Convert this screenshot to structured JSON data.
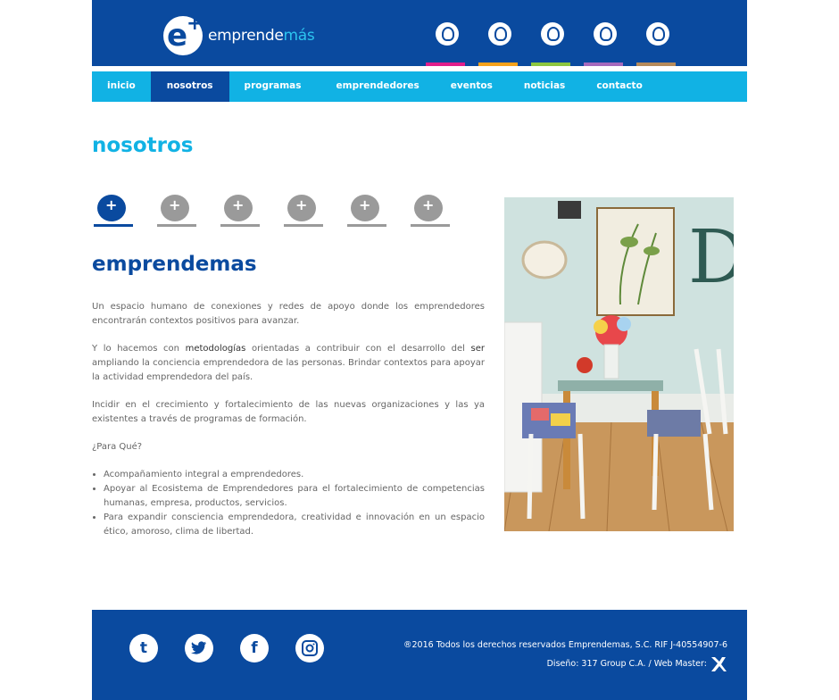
{
  "logo": {
    "text_main": "emprende",
    "text_accent": "más",
    "mark": "e+"
  },
  "header_icons": [
    {
      "icon": "hand-plus-icon",
      "color": "#e01e8c"
    },
    {
      "icon": "head-plus-icon",
      "color": "#f7a21b"
    },
    {
      "icon": "sprout-plus-icon",
      "color": "#8cc63f"
    },
    {
      "icon": "hand-heart-icon",
      "color": "#a569bd"
    },
    {
      "icon": "arrow-up-plus-icon",
      "color": "#b58a5a"
    }
  ],
  "nav": {
    "items": [
      "inicio",
      "nosotros",
      "programas",
      "emprendedores",
      "eventos",
      "noticias",
      "contacto"
    ],
    "active": "nosotros"
  },
  "page_title": "nosotros",
  "tabs": [
    {
      "icon": "emprendemas-logo-icon",
      "active": true
    },
    {
      "icon": "hand-plus-icon",
      "active": false
    },
    {
      "icon": "head-plus-icon",
      "active": false
    },
    {
      "icon": "sprout-plus-icon",
      "active": false
    },
    {
      "icon": "hand-heart-icon",
      "active": false
    },
    {
      "icon": "arrow-up-plus-icon",
      "active": false
    }
  ],
  "section_title": "emprendemas",
  "paragraphs": {
    "p1": "Un espacio humano de conexiones y redes de apoyo donde los emprendedores encontrarán contextos positivos para avanzar.",
    "p2_a": "Y lo hacemos con ",
    "p2_strong1": "metodologías",
    "p2_b": " orientadas a contribuir con el desarrollo del ",
    "p2_strong2": "ser",
    "p2_c": " ampliando la conciencia emprendedora de las personas. Brindar contextos para apoyar la actividad emprendedora del país.",
    "p3": "Incidir en el crecimiento y fortalecimiento de las nuevas organizaciones y las ya existentes a través de programas de formación.",
    "p4": "¿Para Qué?"
  },
  "bullets": [
    "Acompañamiento integral a emprendedores.",
    "Apoyar al Ecosistema de Emprendedores para el fortalecimiento de competencias humanas, empresa, productos, servicios.",
    "Para expandir consciencia emprendedora, creatividad e innovación en un espacio ético, amoroso, clima de libertad."
  ],
  "footer": {
    "social": [
      {
        "icon": "tumblr-icon",
        "glyph": "t"
      },
      {
        "icon": "twitter-icon",
        "glyph": "🐦"
      },
      {
        "icon": "facebook-icon",
        "glyph": "f"
      },
      {
        "icon": "instagram-icon",
        "glyph": "◎"
      }
    ],
    "copyright": "®2016 Todos los derechos reservados Emprendemas, S.C. RIF J-40554907-6",
    "credits": "Diseño: 317 Group C.A. / Web Master:"
  },
  "colors": {
    "brand_blue": "#0a4a9f",
    "accent_cyan": "#11b2e4"
  }
}
